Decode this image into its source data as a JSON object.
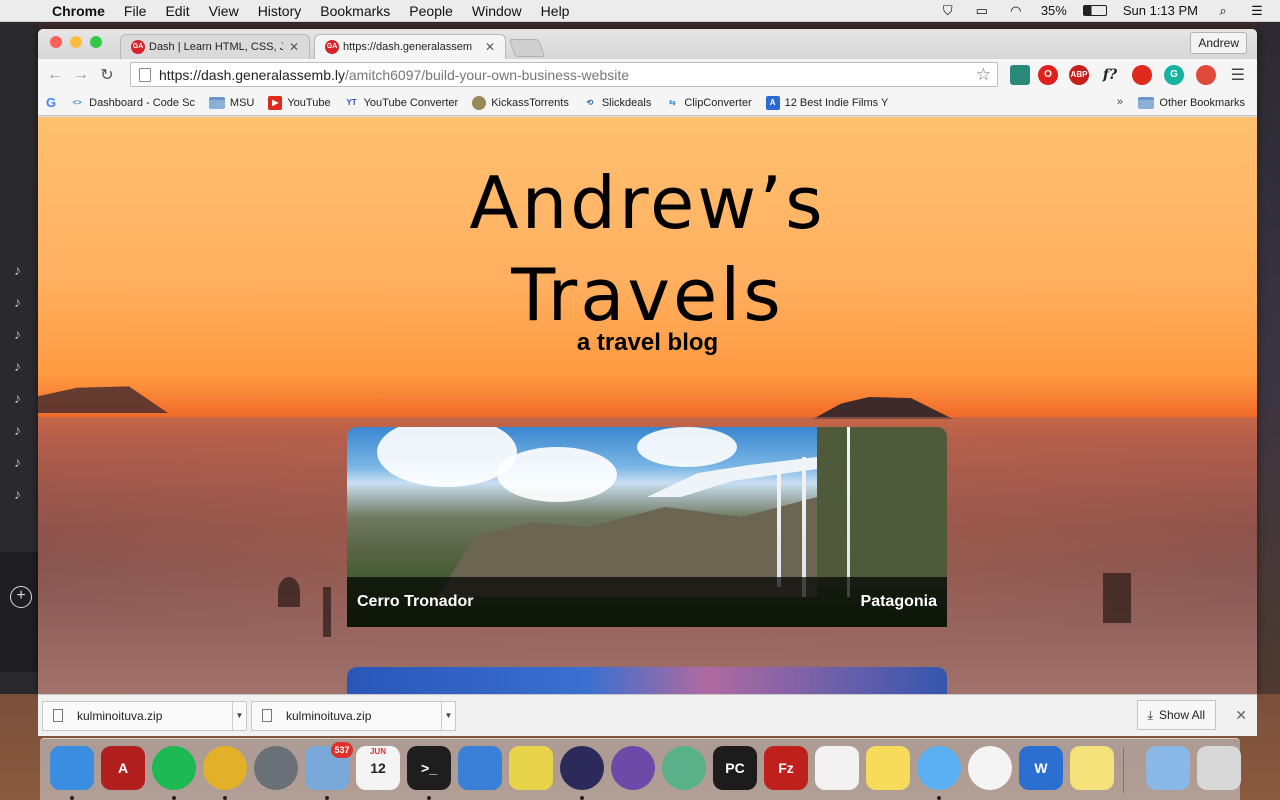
{
  "menubar": {
    "app_name": "Chrome",
    "items": [
      "File",
      "Edit",
      "View",
      "History",
      "Bookmarks",
      "People",
      "Window",
      "Help"
    ],
    "battery": "35%",
    "clock": "Sun 1:13 PM"
  },
  "browser": {
    "tabs": [
      {
        "title": "Dash | Learn HTML, CSS, J",
        "favicon": "GA"
      },
      {
        "title": "https://dash.generalassem",
        "favicon": "GA"
      }
    ],
    "profile_name": "Andrew",
    "url_host": "https://dash.generalassemb.ly",
    "url_path": "/amitch6097/build-your-own-business-website",
    "bookmarks": [
      {
        "label": "Dashboard - Code Sc",
        "icon": "code-icon"
      },
      {
        "label": "MSU",
        "icon": "folder-icon"
      },
      {
        "label": "YouTube",
        "icon": "youtube-icon"
      },
      {
        "label": "YouTube Converter",
        "icon": "mp3-icon"
      },
      {
        "label": "KickassTorrents",
        "icon": "shield-icon"
      },
      {
        "label": "Slickdeals",
        "icon": "slickdeals-icon"
      },
      {
        "label": "ClipConverter",
        "icon": "clip-icon"
      },
      {
        "label": "12 Best Indie Films Y",
        "icon": "bookmark-icon"
      }
    ],
    "bookmarks_more": "»",
    "other_bookmarks": "Other Bookmarks",
    "extensions": [
      {
        "name": "eyedropper-icon",
        "label": ""
      },
      {
        "name": "opera-icon",
        "label": "O"
      },
      {
        "name": "adblock-icon",
        "label": "ABP"
      },
      {
        "name": "font-icon",
        "label": "f?"
      },
      {
        "name": "flash-icon",
        "label": ""
      },
      {
        "name": "grammarly-icon",
        "label": "G"
      },
      {
        "name": "gear-ext-icon",
        "label": ""
      }
    ]
  },
  "page": {
    "title": "Andrew's Travels",
    "title_line1": "Andrew’s",
    "title_line2": "Travels",
    "subtitle": "a travel blog",
    "cards": [
      {
        "name": "Cerro Tronador",
        "location": "Patagonia"
      }
    ]
  },
  "downloads": {
    "items": [
      "kulminoituva.zip",
      "kulminoituva.zip"
    ],
    "show_all": "Show All"
  },
  "dock": {
    "apps": [
      {
        "name": "finder-icon",
        "color": "#3a8de0",
        "label": ""
      },
      {
        "name": "acrobat-icon",
        "color": "#b01e1e",
        "label": "A"
      },
      {
        "name": "spotify-icon",
        "color": "#1db954",
        "label": ""
      },
      {
        "name": "chrome-icon",
        "color": "#e3b02a",
        "label": ""
      },
      {
        "name": "launchpad-icon",
        "color": "#6a7078",
        "label": ""
      },
      {
        "name": "mail-icon",
        "color": "#7aa8d8",
        "label": ""
      },
      {
        "name": "calendar-icon",
        "color": "#f4f4f4",
        "label": "12"
      },
      {
        "name": "terminal-icon",
        "color": "#1e1e1e",
        "label": ">_"
      },
      {
        "name": "xcode-icon",
        "color": "#3a80d8",
        "label": ""
      },
      {
        "name": "python-icon",
        "color": "#e8d44a",
        "label": ""
      },
      {
        "name": "eclipse-icon",
        "color": "#2c2a5a",
        "label": ""
      },
      {
        "name": "github-icon",
        "color": "#6e4aa8",
        "label": ""
      },
      {
        "name": "atom-icon",
        "color": "#5ab088",
        "label": ""
      },
      {
        "name": "pycharm-icon",
        "color": "#1c1c1c",
        "label": "PC"
      },
      {
        "name": "filezilla-icon",
        "color": "#c0201c",
        "label": "Fz"
      },
      {
        "name": "textedit-icon",
        "color": "#f2f2f2",
        "label": ""
      },
      {
        "name": "notes-icon",
        "color": "#f6dc5a",
        "label": ""
      },
      {
        "name": "messages-icon",
        "color": "#5ab0f0",
        "label": ""
      },
      {
        "name": "itunes-icon",
        "color": "#f4f4f4",
        "label": ""
      },
      {
        "name": "word-icon",
        "color": "#2b6fd0",
        "label": "W"
      },
      {
        "name": "stickies-icon",
        "color": "#f6e27a",
        "label": ""
      },
      {
        "name": "downloads-folder-icon",
        "color": "#8ab8e6",
        "label": ""
      },
      {
        "name": "trash-icon",
        "color": "#d8d8d8",
        "label": ""
      }
    ],
    "mail_badge": "537",
    "calendar_month": "JUN"
  }
}
